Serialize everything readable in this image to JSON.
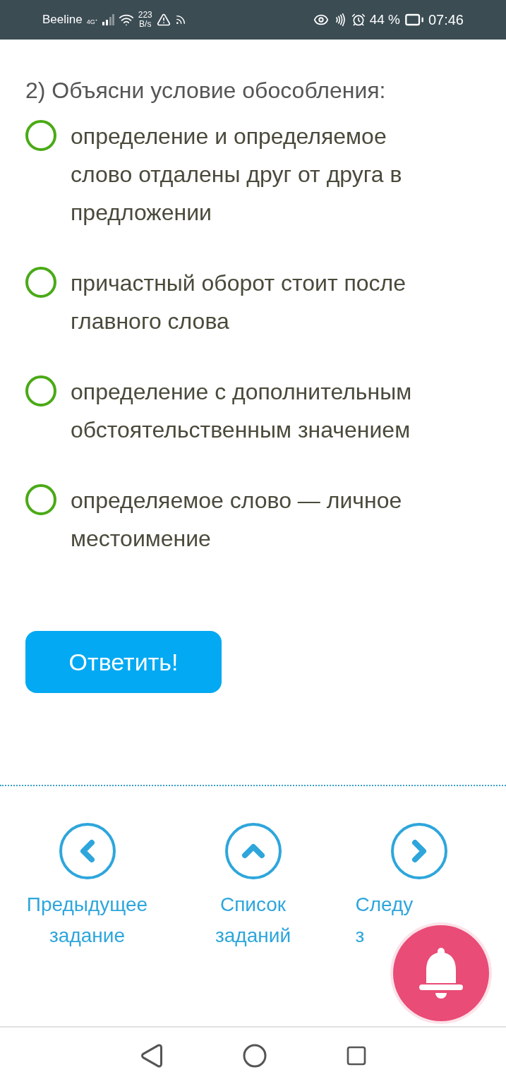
{
  "status_bar": {
    "carrier": "Beeline",
    "network": "4G⁺",
    "speed_value": "223",
    "speed_unit": "B/s",
    "battery": "44 %",
    "time": "07:46"
  },
  "question": {
    "title": "2) Объясни условие обособления:",
    "options": [
      {
        "text": "определение и определяемое слово отдалены друг от друга в предложении",
        "selected": false
      },
      {
        "text": "причастный оборот стоит после главного слова",
        "selected": false
      },
      {
        "text": "определение с дополнительным обстоятельственным значением",
        "selected": false
      },
      {
        "text": "определяемое слово — личное местоимение",
        "selected": false
      }
    ]
  },
  "submit_button": "Ответить!",
  "nav": [
    {
      "kind": "prev",
      "lines": [
        "Предыдущее",
        "задание"
      ]
    },
    {
      "kind": "list",
      "lines": [
        "Список",
        "заданий"
      ]
    },
    {
      "kind": "next",
      "lines": [
        "Следу",
        "з"
      ]
    }
  ]
}
